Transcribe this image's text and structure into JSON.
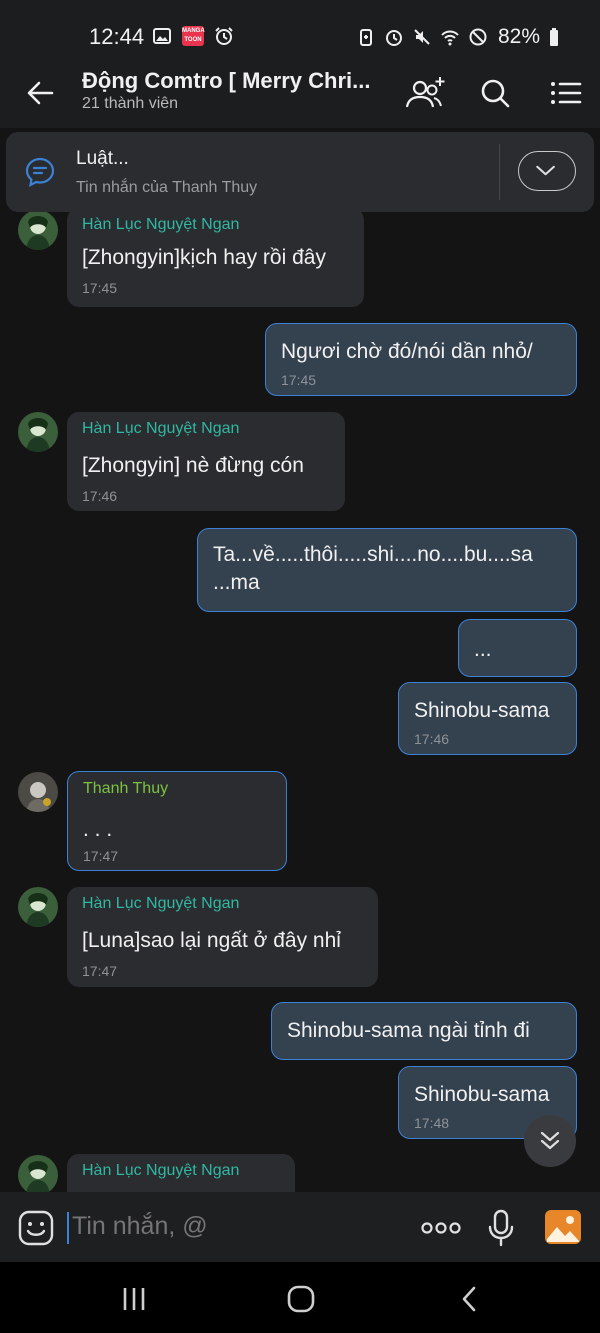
{
  "status_bar": {
    "time": "12:44",
    "manga_badge": "MANGA TOON",
    "battery": "82%"
  },
  "header": {
    "title": "Động Comtro [ Merry Chri...",
    "subtitle": "21 thành viên",
    "icons": [
      "back-arrow-icon",
      "add-member-icon",
      "search-icon",
      "menu-list-icon"
    ]
  },
  "pinned": {
    "title": "Luật...",
    "subtitle": "Tin nhắn của Thanh Thuy"
  },
  "messages": [
    {
      "direction": "in",
      "sender": "Hàn Lục Nguyệt Ngan",
      "text": "[Zhongyin]kịch hay rồi đây",
      "time": "17:45"
    },
    {
      "direction": "out",
      "text": "Ngươi chờ đó/nói dần nhỏ/",
      "time": "17:45"
    },
    {
      "direction": "in",
      "sender": "Hàn Lục Nguyệt Ngan",
      "text": "[Zhongyin] nè đừng cón",
      "time": "17:46"
    },
    {
      "direction": "out",
      "text_line1": "Ta...về.....thôi.....shi....no....bu....sa",
      "text_line2": "...ma"
    },
    {
      "direction": "out",
      "text": "..."
    },
    {
      "direction": "out",
      "text": "Shinobu-sama",
      "time": "17:46"
    },
    {
      "direction": "in",
      "sender": "Thanh Thuy",
      "text": ". . .",
      "time": "17:47"
    },
    {
      "direction": "in",
      "sender": "Hàn Lục Nguyệt Ngan",
      "text": "[Luna]sao lại ngất ở đây nhỉ",
      "time": "17:47"
    },
    {
      "direction": "out",
      "text": "Shinobu-sama ngài tỉnh đi"
    },
    {
      "direction": "out",
      "text": "Shinobu-sama",
      "time": "17:48"
    },
    {
      "direction": "in",
      "sender": "Hàn Lục Nguyệt Ngan"
    }
  ],
  "input": {
    "placeholder": "Tin nhắn, @"
  },
  "colors": {
    "accent": "#3b82d6",
    "sender_teal": "#2fb8a3",
    "sender_green": "#7cc241",
    "incoming_bubble": "#2b2c2f",
    "outgoing_bubble": "#34414f"
  }
}
